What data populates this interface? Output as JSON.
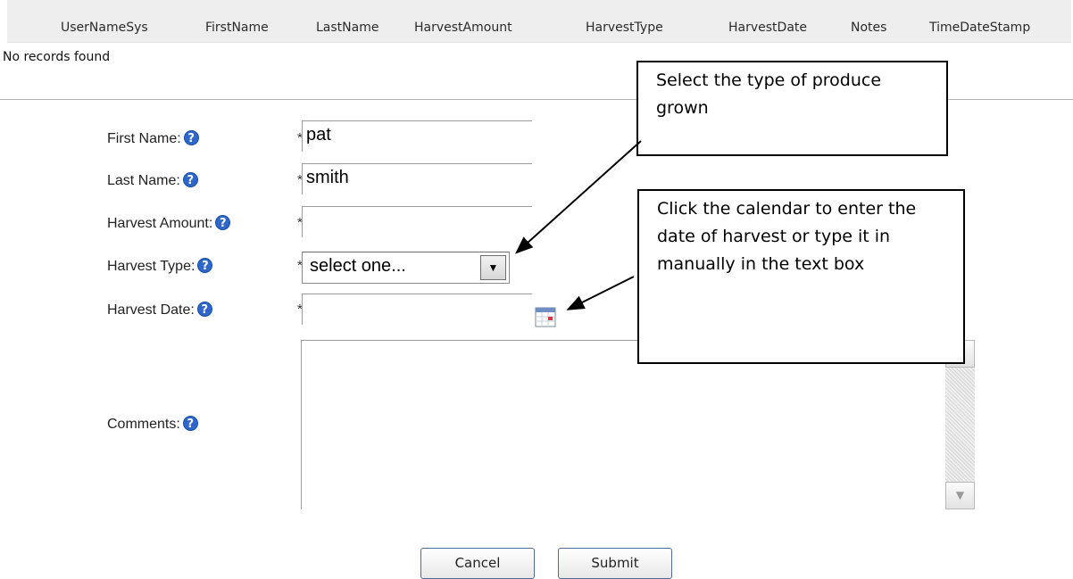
{
  "grid": {
    "columns": [
      "UserNameSys",
      "FirstName",
      "LastName",
      "HarvestAmount",
      "HarvestType",
      "HarvestDate",
      "Notes",
      "TimeDateStamp"
    ],
    "empty_message": "No records found"
  },
  "form": {
    "required_mark": "*",
    "help_glyph": "?",
    "first_name": {
      "label": "First Name:",
      "value": "pat"
    },
    "last_name": {
      "label": "Last Name:",
      "value": "smith"
    },
    "harvest_amount": {
      "label": "Harvest Amount:",
      "value": ""
    },
    "harvest_type": {
      "label": "Harvest Type:",
      "selected": "select one..."
    },
    "harvest_date": {
      "label": "Harvest Date:",
      "value": ""
    },
    "comments": {
      "label": "Comments:",
      "value": ""
    }
  },
  "buttons": {
    "cancel": "Cancel",
    "submit": "Submit"
  },
  "callouts": {
    "type_hint": "Select the type of produce grown",
    "date_hint": "Click the calendar to enter the date of harvest or type it in manually in the text box"
  },
  "colors": {
    "help_icon": "#2e67c9",
    "button_border": "#4e6b96",
    "header_bg": "#eeeeee"
  }
}
